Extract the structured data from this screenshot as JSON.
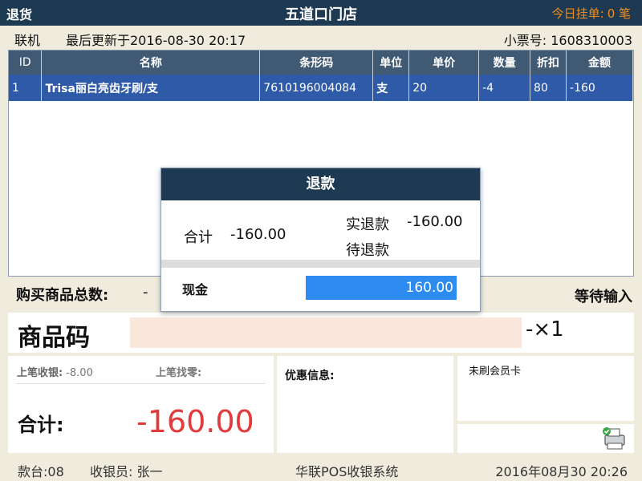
{
  "titlebar": {
    "mode": "退货",
    "store": "五道口门店",
    "held_label": "今日挂单:",
    "held_count": "0 笔"
  },
  "status": {
    "online": "联机",
    "last_update": "最后更新于2016-08-30 20:17",
    "ticket_label": "小票号:",
    "ticket_no": "1608310003"
  },
  "table": {
    "headers": [
      "ID",
      "名称",
      "条形码",
      "单位",
      "单价",
      "数量",
      "折扣",
      "金额"
    ],
    "rows": [
      {
        "id": "1",
        "name": "Trisa丽白亮齿牙刷/支",
        "barcode": "7610196004084",
        "unit": "支",
        "price": "20",
        "qty": "-4",
        "discount": "80",
        "amount": "-160"
      }
    ]
  },
  "summary": {
    "count_label": "购买商品总数:",
    "count_value": "-",
    "state": "等待输入"
  },
  "scan": {
    "label": "商品码",
    "value": "",
    "qty": "-×1"
  },
  "totals": {
    "last_paid_label": "上笔收银:",
    "last_paid_value": "-8.00",
    "last_change_label": "上笔找零:",
    "total_label": "合计:",
    "total_value": "-160.00"
  },
  "promo": {
    "label": "优惠信息:"
  },
  "member": {
    "label": "未刷会员卡"
  },
  "footer": {
    "terminal": "款台:08",
    "cashier": "收银员: 张一",
    "system": "华联POS收银系统",
    "datetime": "2016年08月30  20:26"
  },
  "refund_modal": {
    "title": "退款",
    "total_label": "合计",
    "total_value": "-160.00",
    "actual_label": "实退款",
    "actual_value": "-160.00",
    "pending_label": "待退款",
    "cash_label": "现金",
    "cash_value": "160.00"
  },
  "colors": {
    "titlebar_bg": "#1e3a52",
    "held_text": "#f08c1a",
    "row_selected": "#2f5aa8",
    "total_red": "#e23b3b",
    "cash_input": "#2e8cf0"
  }
}
